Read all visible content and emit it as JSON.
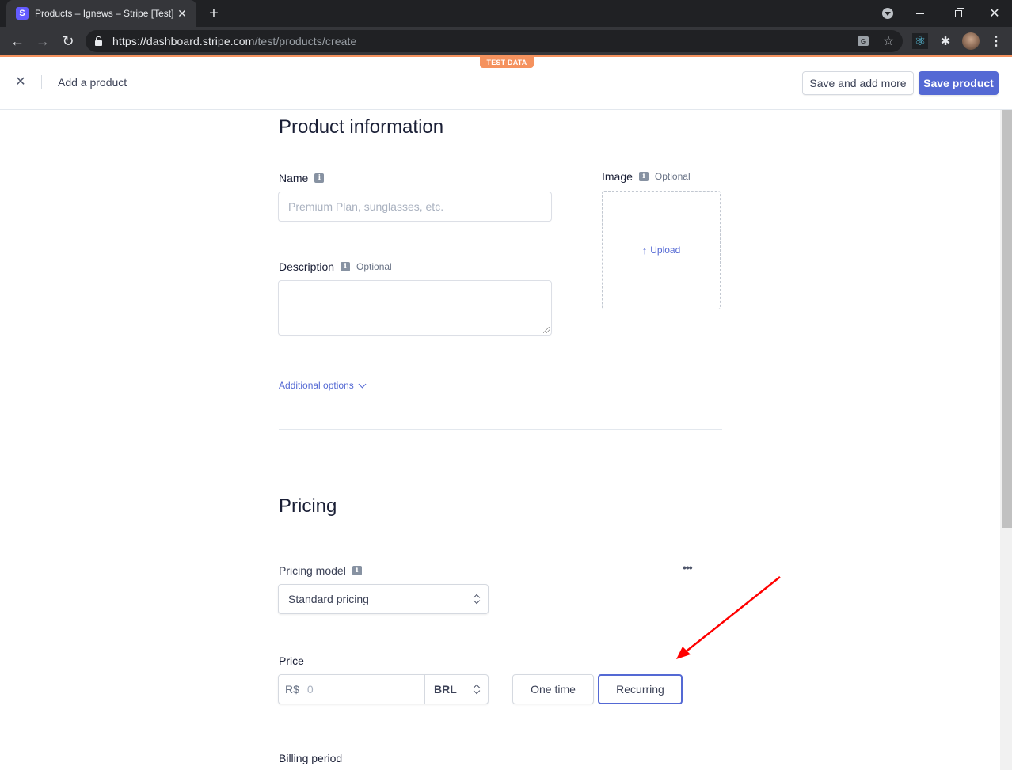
{
  "browser": {
    "tab_title": "Products – Ignews – Stripe [Test]",
    "favicon_letter": "S",
    "url_host": "https://dashboard.stripe.com",
    "url_path": "/test/products/create",
    "icons": {
      "close_tab": "✕",
      "new_tab": "+",
      "back": "←",
      "forward": "→",
      "reload": "↻",
      "translate": "G",
      "star": "☆",
      "react": "⚛",
      "puzzle": "✱",
      "menu": "⋮",
      "close_window": "✕"
    }
  },
  "test_badge": "TEST DATA",
  "header": {
    "close_icon": "✕",
    "title": "Add a product",
    "save_and_add_more": "Save and add more",
    "save_product": "Save product"
  },
  "product_info": {
    "heading": "Product information",
    "name_label": "Name",
    "name_placeholder": "Premium Plan, sunglasses, etc.",
    "name_value": "",
    "description_label": "Description",
    "description_optional": "Optional",
    "description_value": "",
    "image_label": "Image",
    "image_optional": "Optional",
    "upload_arrow": "↑",
    "upload_label": "Upload",
    "additional_options": "Additional options",
    "info_glyph": "i"
  },
  "pricing": {
    "heading": "Pricing",
    "model_label": "Pricing model",
    "model_value": "Standard pricing",
    "more_icon": "•••",
    "price_label": "Price",
    "currency_prefix": "R$",
    "amount_placeholder": "0",
    "currency_value": "BRL",
    "one_time_label": "One time",
    "recurring_label": "Recurring",
    "billing_period_label": "Billing period"
  },
  "colors": {
    "accent": "#5469d4",
    "test_badge": "#f5925e",
    "annotation_arrow": "#ff0000"
  }
}
